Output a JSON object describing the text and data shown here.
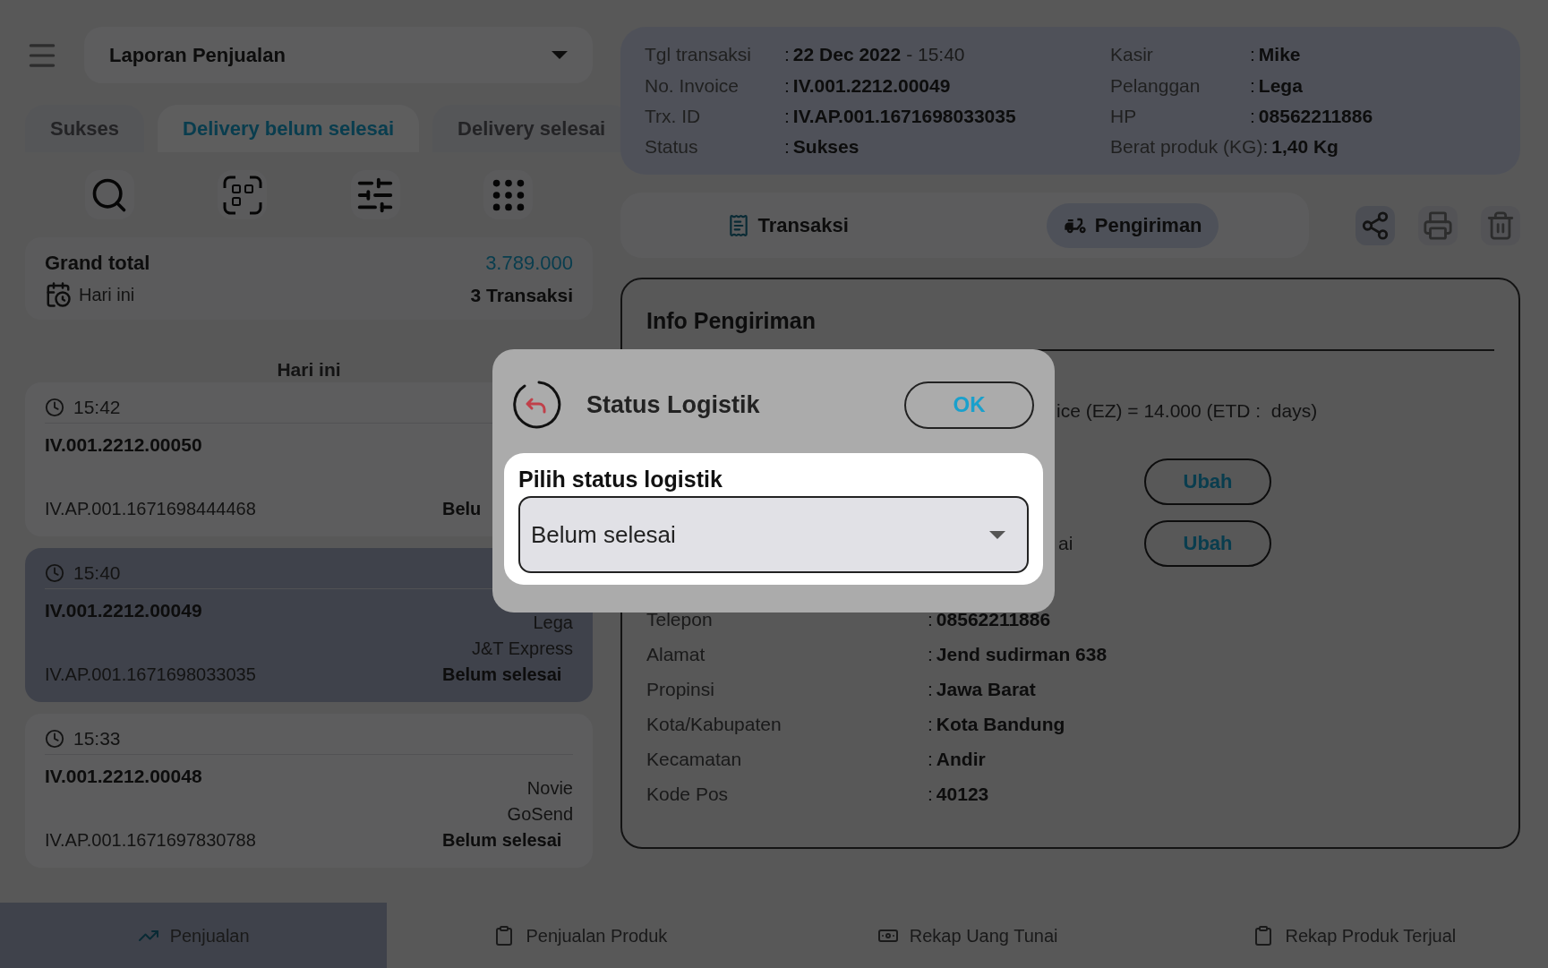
{
  "header": {
    "title": "Laporan Penjualan"
  },
  "tabs": [
    {
      "label": "Sukses",
      "selected": false
    },
    {
      "label": "Delivery belum selesai",
      "selected": true
    },
    {
      "label": "Delivery selesai",
      "selected": false
    }
  ],
  "summary": {
    "label": "Grand total",
    "amount": "3.789.000",
    "period": "Hari ini",
    "count": "3 Transaksi"
  },
  "list_heading": "Hari ini",
  "transactions": [
    {
      "time": "15:42",
      "invoice": "IV.001.2212.00050",
      "trx_id": "IV.AP.001.1671698444468",
      "status": "Belu",
      "selected": false
    },
    {
      "time": "15:40",
      "invoice": "IV.001.2212.00049",
      "customer": "Lega",
      "courier": "J&T Express",
      "trx_id": "IV.AP.001.1671698033035",
      "status": "Belum selesai",
      "selected": true
    },
    {
      "time": "15:33",
      "invoice": "IV.001.2212.00048",
      "customer": "Novie",
      "courier": "GoSend",
      "trx_id": "IV.AP.001.1671697830788",
      "status": "Belum selesai",
      "selected": false
    }
  ],
  "detail": {
    "left": [
      {
        "label": "Tgl transaksi",
        "colon": ":",
        "value": "22 Dec 2022",
        "extra": "- 15:40"
      },
      {
        "label": "No. Invoice",
        "colon": ":",
        "value": "IV.001.2212.00049"
      },
      {
        "label": "Trx. ID",
        "colon": ":",
        "value": "IV.AP.001.1671698033035"
      },
      {
        "label": "Status",
        "colon": ":",
        "value": "Sukses"
      }
    ],
    "right": [
      {
        "label": "Kasir",
        "colon": ":",
        "value": "Mike"
      },
      {
        "label": "Pelanggan",
        "colon": ":",
        "value": "Lega"
      },
      {
        "label": "HP",
        "colon": ":",
        "value": "08562211886"
      },
      {
        "label": "Berat produk (KG)",
        "colon": ":",
        "value": "1,40 Kg"
      }
    ]
  },
  "detail_tabs": [
    {
      "label": "Transaksi",
      "selected": false
    },
    {
      "label": "Pengiriman",
      "selected": true
    }
  ],
  "shipping": {
    "title": "Info Pengiriman",
    "service_text": "ice (EZ) = 14.000 (ETD :  days)",
    "partial_label": "ai",
    "buttons": [
      "Ubah",
      "Ubah"
    ],
    "fields": [
      {
        "label": "Telepon",
        "colon": ":",
        "value": "08562211886"
      },
      {
        "label": "Alamat",
        "colon": ":",
        "value": "Jend sudirman 638"
      },
      {
        "label": "Propinsi",
        "colon": ":",
        "value": "Jawa Barat"
      },
      {
        "label": "Kota/Kabupaten",
        "colon": ":",
        "value": "Kota Bandung"
      },
      {
        "label": "Kecamatan",
        "colon": ":",
        "value": "Andir"
      },
      {
        "label": "Kode Pos",
        "colon": ":",
        "value": "40123"
      }
    ]
  },
  "dialog": {
    "title": "Status Logistik",
    "ok": "OK",
    "field_label": "Pilih status logistik",
    "value": "Belum selesai"
  },
  "bottom_nav": [
    {
      "label": "Penjualan",
      "kind": "chart",
      "selected": true
    },
    {
      "label": "Penjualan Produk",
      "kind": "clipboard",
      "selected": false
    },
    {
      "label": "Rekap Uang Tunai",
      "kind": "money",
      "selected": false
    },
    {
      "label": "Rekap Produk Terjual",
      "kind": "clipboard",
      "selected": false
    }
  ]
}
